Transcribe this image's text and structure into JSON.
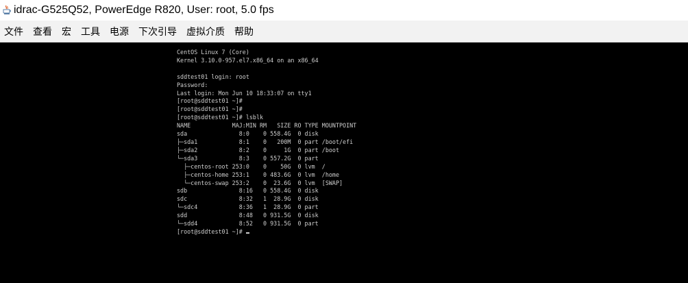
{
  "window": {
    "title": "idrac-G525Q52, PowerEdge R820, User: root, 5.0 fps",
    "icon": "java-icon"
  },
  "menu": {
    "items": [
      "文件",
      "查看",
      "宏",
      "工具",
      "电源",
      "下次引导",
      "虚拟介质",
      "帮助"
    ]
  },
  "console": {
    "lines": [
      "CentOS Linux 7 (Core)",
      "Kernel 3.10.0-957.el7.x86_64 on an x86_64",
      "",
      "sddtest01 login: root",
      "Password:",
      "Last login: Mon Jun 10 18:33:07 on tty1",
      "[root@sddtest01 ~]#",
      "[root@sddtest01 ~]#",
      "[root@sddtest01 ~]# lsblk",
      "NAME            MAJ:MIN RM   SIZE RO TYPE MOUNTPOINT",
      "sda               8:0    0 558.4G  0 disk",
      "├─sda1            8:1    0   200M  0 part /boot/efi",
      "├─sda2            8:2    0     1G  0 part /boot",
      "└─sda3            8:3    0 557.2G  0 part",
      "  ├─centos-root 253:0    0    50G  0 lvm  /",
      "  ├─centos-home 253:1    0 483.6G  0 lvm  /home",
      "  └─centos-swap 253:2    0  23.6G  0 lvm  [SWAP]",
      "sdb               8:16   0 558.4G  0 disk",
      "sdc               8:32   1  28.9G  0 disk",
      "└─sdc4            8:36   1  28.9G  0 part",
      "sdd               8:48   0 931.5G  0 disk",
      "└─sdd4            8:52   0 931.5G  0 part"
    ],
    "prompt": "[root@sddtest01 ~]# ",
    "foreground_color": "#cfcfcf",
    "background_color": "#000000"
  }
}
